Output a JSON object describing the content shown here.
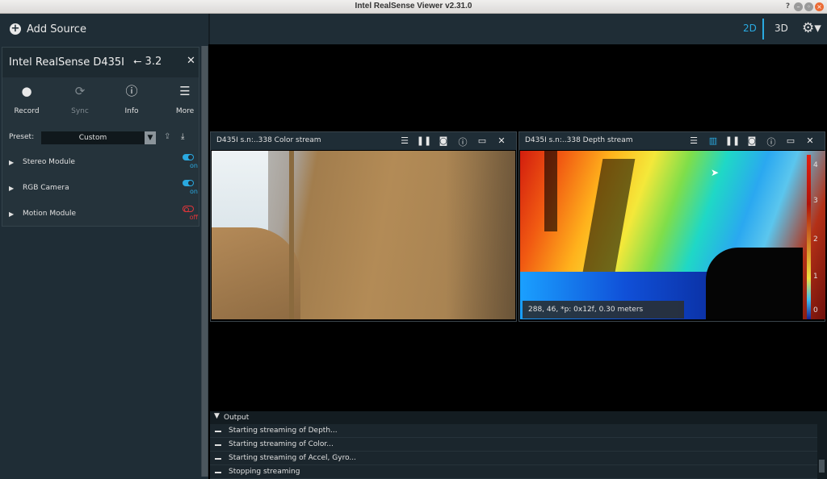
{
  "window": {
    "title": "Intel RealSense Viewer v2.31.0",
    "help_symbol": "?",
    "min_symbol": "–",
    "max_symbol": "◦",
    "close_symbol": "×"
  },
  "toolbar": {
    "add_source_label": "Add Source",
    "view_2d": "2D",
    "view_3d": "3D",
    "settings_icon": "gear-icon",
    "accent_color": "#2aa9e0"
  },
  "device": {
    "name": "Intel RealSense D435I",
    "usb_version": "3.2",
    "actions": [
      {
        "label": "Record",
        "icon": "record-icon"
      },
      {
        "label": "Sync",
        "icon": "sync-icon"
      },
      {
        "label": "Info",
        "icon": "info-icon"
      },
      {
        "label": "More",
        "icon": "menu-icon"
      }
    ],
    "preset_label": "Preset:",
    "preset_value": "Custom",
    "modules": [
      {
        "name": "Stereo Module",
        "state": "on"
      },
      {
        "name": "RGB Camera",
        "state": "on"
      },
      {
        "name": "Motion Module",
        "state": "off"
      }
    ]
  },
  "streams": {
    "color": {
      "title": "D435I s.n:..338 Color stream"
    },
    "depth": {
      "title": "D435I s.n:..338 Depth stream",
      "readout": "288, 46, *p: 0x12f, 0.30 meters",
      "colorbar_ticks": [
        "4",
        "3",
        "2",
        "1",
        "0"
      ]
    }
  },
  "output": {
    "title": "Output",
    "lines": [
      "Starting streaming of Depth...",
      "Starting streaming of Color...",
      "Starting streaming of Accel, Gyro...",
      "Stopping streaming"
    ]
  }
}
